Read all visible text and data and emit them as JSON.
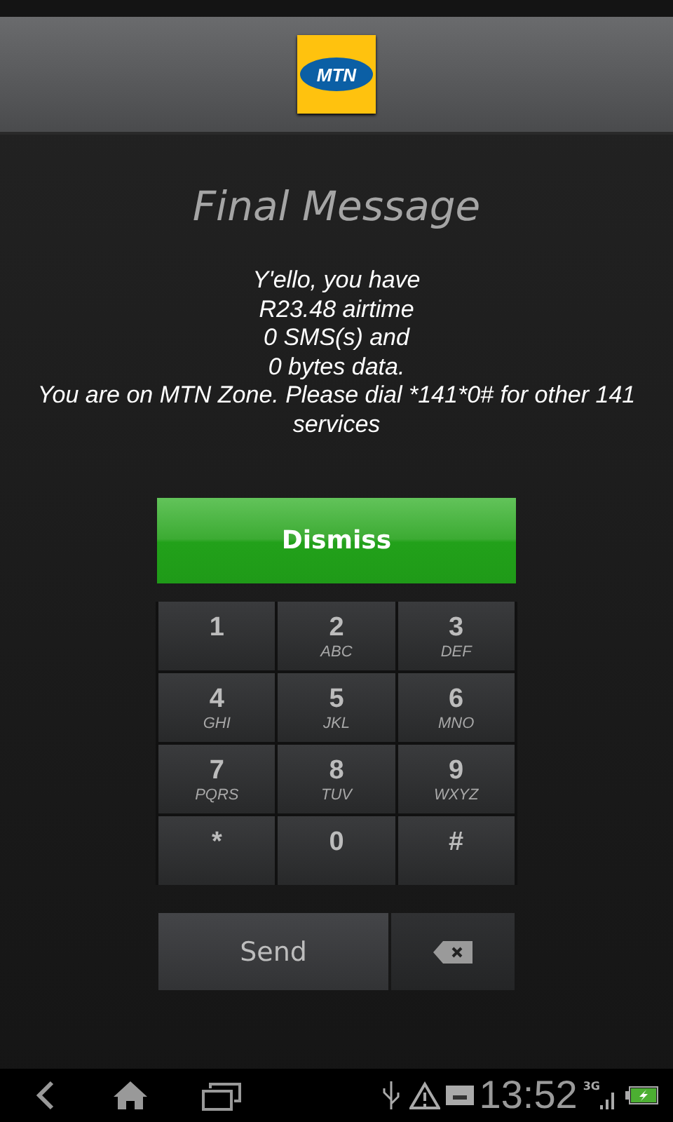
{
  "header": {
    "logo_text": "MTN"
  },
  "title": "Final Message",
  "message": "Y'ello, you have\nR23.48 airtime \n 0 SMS(s) and\n0 bytes data.\nYou are on MTN Zone. Please dial *141*0# for other 141 services",
  "dismiss_button": "Dismiss",
  "keypad": [
    {
      "digit": "1"
    },
    {
      "digit": "2",
      "letters": "ABC"
    },
    {
      "digit": "3",
      "letters": "DEF"
    },
    {
      "digit": "4",
      "letters": "GHI"
    },
    {
      "digit": "5",
      "letters": "JKL"
    },
    {
      "digit": "6",
      "letters": "MNO"
    },
    {
      "digit": "7",
      "letters": "PQRS"
    },
    {
      "digit": "8",
      "letters": "TUV"
    },
    {
      "digit": "9",
      "letters": "WXYZ"
    },
    {
      "digit": "*"
    },
    {
      "digit": "0"
    },
    {
      "digit": "#"
    }
  ],
  "send_button": "Send",
  "status_bar": {
    "time": "13:52",
    "network": "3G",
    "battery_charging": true
  }
}
